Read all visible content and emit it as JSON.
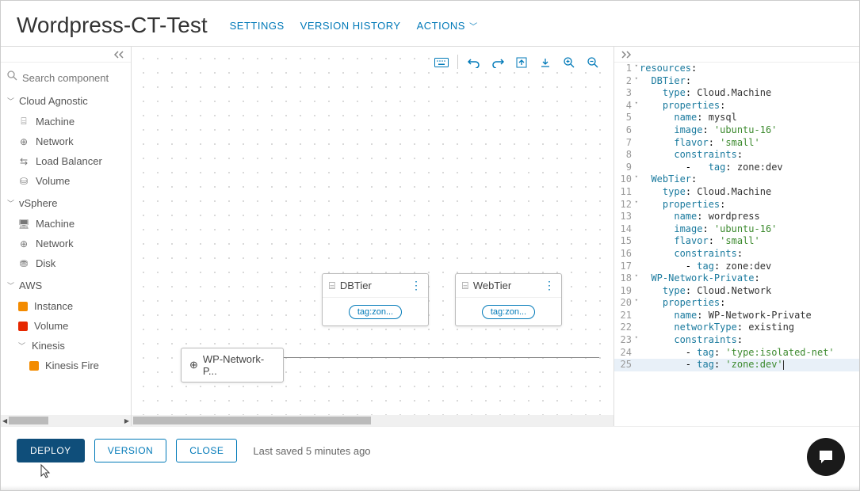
{
  "header": {
    "title": "Wordpress-CT-Test",
    "settings": "SETTINGS",
    "versionHistory": "VERSION HISTORY",
    "actions": "ACTIONS"
  },
  "sidebar": {
    "searchPlaceholder": "Search component",
    "categories": [
      {
        "name": "Cloud Agnostic",
        "items": [
          "Machine",
          "Network",
          "Load Balancer",
          "Volume"
        ]
      },
      {
        "name": "vSphere",
        "items": [
          "Machine",
          "Network",
          "Disk"
        ]
      },
      {
        "name": "AWS",
        "items": [
          "Instance",
          "Volume",
          "Kinesis"
        ],
        "nested": [
          "Kinesis Fire"
        ]
      }
    ]
  },
  "canvas": {
    "nodes": {
      "db": {
        "label": "DBTier",
        "tag": "tag:zon..."
      },
      "web": {
        "label": "WebTier",
        "tag": "tag:zon..."
      },
      "net": {
        "label": "WP-Network-P..."
      }
    }
  },
  "code": {
    "lines": [
      {
        "n": 1,
        "fold": true,
        "html": "<span class='kw-key'>resources</span>:"
      },
      {
        "n": 2,
        "fold": true,
        "html": "  <span class='kw-key'>DBTier</span>:"
      },
      {
        "n": 3,
        "html": "    <span class='kw-key'>type</span>: <span class='kw-val'>Cloud.Machine</span>"
      },
      {
        "n": 4,
        "fold": true,
        "html": "    <span class='kw-key'>properties</span>:"
      },
      {
        "n": 5,
        "html": "      <span class='kw-key'>name</span>: <span class='kw-val'>mysql</span>"
      },
      {
        "n": 6,
        "html": "      <span class='kw-key'>image</span>: <span class='kw-str'>'ubuntu-16'</span>"
      },
      {
        "n": 7,
        "html": "      <span class='kw-key'>flavor</span>: <span class='kw-str'>'small'</span>"
      },
      {
        "n": 8,
        "html": "      <span class='kw-key'>constraints</span>:"
      },
      {
        "n": 9,
        "html": "        -   <span class='kw-key'>tag</span>: <span class='kw-val'>zone:dev</span>"
      },
      {
        "n": 10,
        "fold": true,
        "html": "  <span class='kw-key'>WebTier</span>:"
      },
      {
        "n": 11,
        "html": "    <span class='kw-key'>type</span>: <span class='kw-val'>Cloud.Machine</span>"
      },
      {
        "n": 12,
        "fold": true,
        "html": "    <span class='kw-key'>properties</span>:"
      },
      {
        "n": 13,
        "html": "      <span class='kw-key'>name</span>: <span class='kw-val'>wordpress</span>"
      },
      {
        "n": 14,
        "html": "      <span class='kw-key'>image</span>: <span class='kw-str'>'ubuntu-16'</span>"
      },
      {
        "n": 15,
        "html": "      <span class='kw-key'>flavor</span>: <span class='kw-str'>'small'</span>"
      },
      {
        "n": 16,
        "html": "      <span class='kw-key'>constraints</span>:"
      },
      {
        "n": 17,
        "html": "        - <span class='kw-key'>tag</span>: <span class='kw-val'>zone:dev</span>"
      },
      {
        "n": 18,
        "fold": true,
        "add": true,
        "html": "  <span class='kw-key'>WP-Network-Private</span>:"
      },
      {
        "n": 19,
        "html": "    <span class='kw-key'>type</span>: <span class='kw-val'>Cloud.Network</span>"
      },
      {
        "n": 20,
        "fold": true,
        "html": "    <span class='kw-key'>properties</span>:"
      },
      {
        "n": 21,
        "html": "      <span class='kw-key'>name</span>: <span class='kw-val'>WP-Network-Private</span>"
      },
      {
        "n": 22,
        "html": "      <span class='kw-key'>networkType</span>: <span class='kw-val'>existing</span>"
      },
      {
        "n": 23,
        "fold": true,
        "html": "      <span class='kw-key'>constraints</span>:"
      },
      {
        "n": 24,
        "html": "        - <span class='kw-key'>tag</span>: <span class='kw-str'>'type:isolated-net'</span>"
      },
      {
        "n": 25,
        "hl": true,
        "html": "        - <span class='kw-key'>tag</span>: <span class='kw-str'>'zone:dev'</span><span class='cursor-bar'></span>"
      }
    ]
  },
  "footer": {
    "deploy": "DEPLOY",
    "version": "VERSION",
    "close": "CLOSE",
    "saved": "Last saved 5 minutes ago"
  }
}
